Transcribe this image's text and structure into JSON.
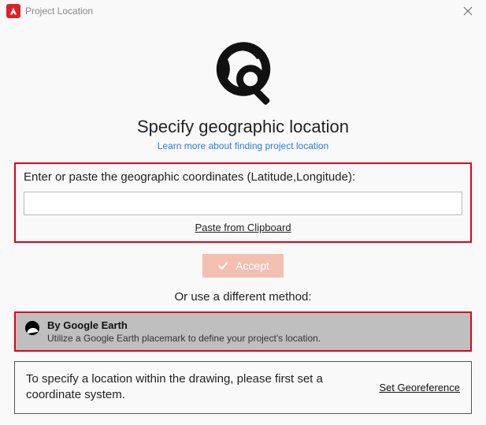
{
  "window": {
    "title": "Project Location"
  },
  "heading": "Specify geographic location",
  "learn_more": "Learn more about finding project location",
  "coord_section": {
    "prompt": "Enter or paste the geographic coordinates (Latitude,Longitude):",
    "input_value": "",
    "paste_label": "Paste from Clipboard"
  },
  "accept_label": "Accept",
  "or_label": "Or use a different method:",
  "method_google_earth": {
    "title": "By Google Earth",
    "desc": "Utilize a Google Earth placemark to define your project's location."
  },
  "georef": {
    "message": "To specify a location within the drawing, please first set a coordinate system.",
    "link": "Set Georeference"
  },
  "colors": {
    "accent_red": "#e1001a",
    "accept_bg": "#f1c0b0",
    "app_brand": "#d9232a",
    "link_blue": "#2a7fd6"
  }
}
